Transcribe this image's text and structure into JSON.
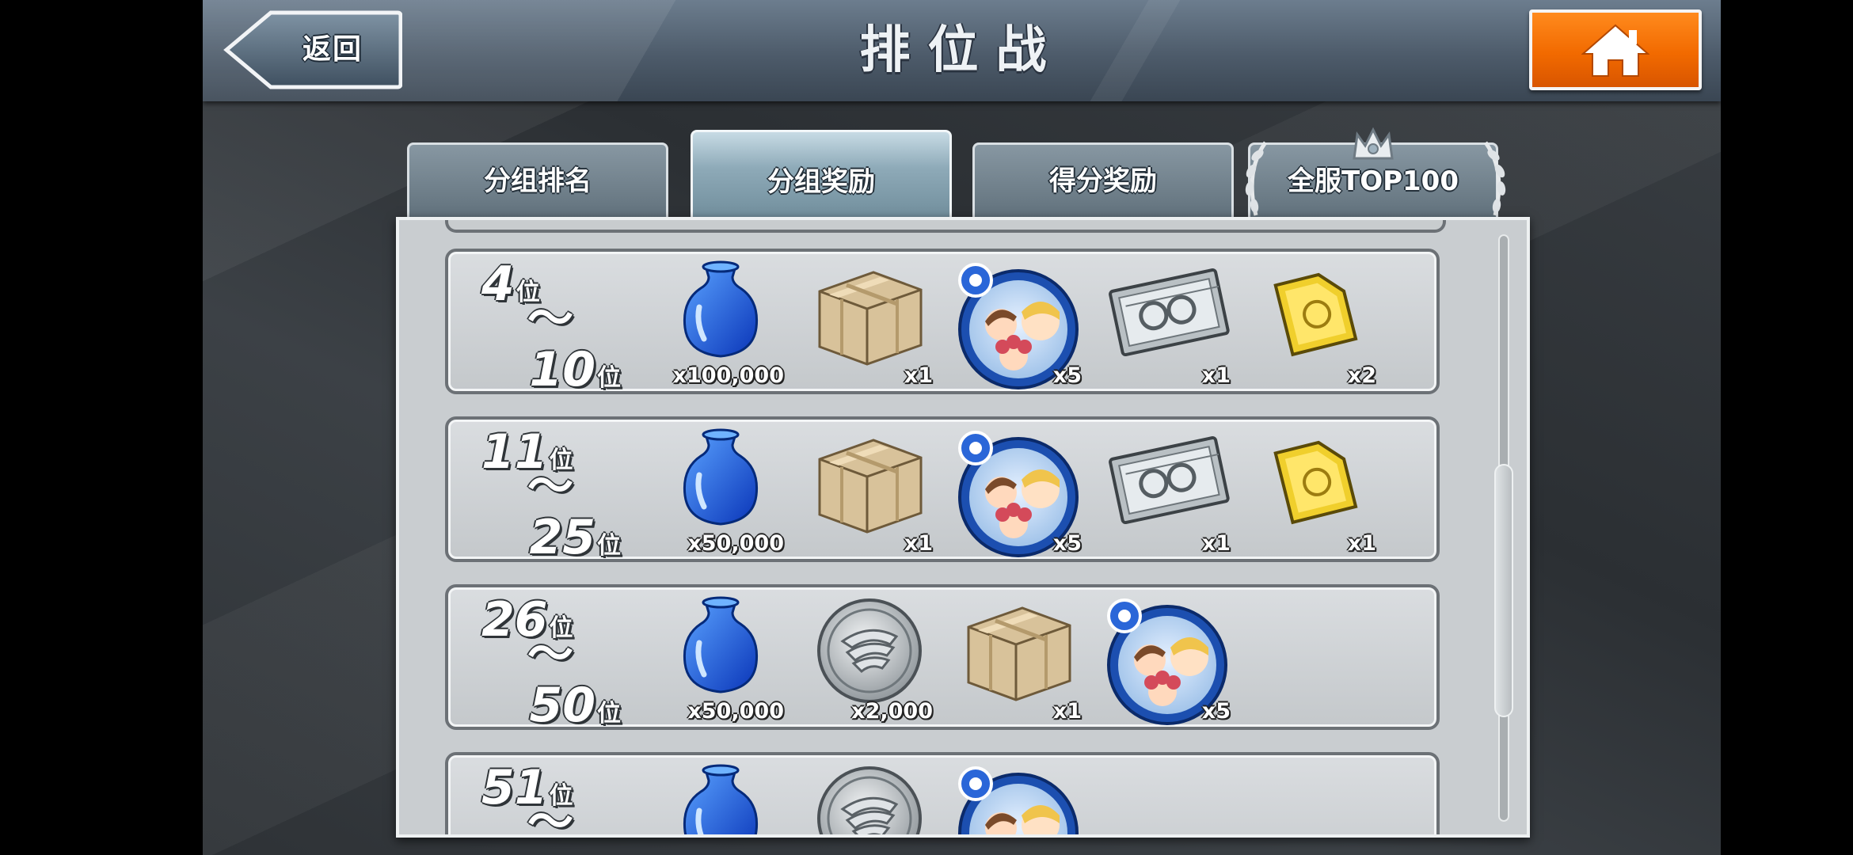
{
  "header": {
    "back_label": "返回",
    "title": "排位战"
  },
  "tabs": [
    {
      "label": "分组排名",
      "active": false
    },
    {
      "label": "分组奖励",
      "active": true
    },
    {
      "label": "得分奖励",
      "active": false
    },
    {
      "label": "全服TOP100",
      "active": false
    }
  ],
  "reward_rows": [
    {
      "rank_from": "4",
      "rank_to": "10",
      "rank_unit": "位",
      "range_separator": "～",
      "rewards": [
        {
          "icon": "blue-potion-icon",
          "qty": "x100,000"
        },
        {
          "icon": "cardboard-box-icon",
          "qty": "x1"
        },
        {
          "icon": "character-medal-icon",
          "qty": "x5"
        },
        {
          "icon": "silver-ticket-icon",
          "qty": "x1"
        },
        {
          "icon": "gold-ticket-icon",
          "qty": "x2"
        }
      ]
    },
    {
      "rank_from": "11",
      "rank_to": "25",
      "rank_unit": "位",
      "range_separator": "～",
      "rewards": [
        {
          "icon": "blue-potion-icon",
          "qty": "x50,000"
        },
        {
          "icon": "cardboard-box-icon",
          "qty": "x1"
        },
        {
          "icon": "character-medal-icon",
          "qty": "x5"
        },
        {
          "icon": "silver-ticket-icon",
          "qty": "x1"
        },
        {
          "icon": "gold-ticket-icon",
          "qty": "x1"
        }
      ]
    },
    {
      "rank_from": "26",
      "rank_to": "50",
      "rank_unit": "位",
      "range_separator": "～",
      "rewards": [
        {
          "icon": "blue-potion-icon",
          "qty": "x50,000"
        },
        {
          "icon": "silver-wing-coin-icon",
          "qty": "x2,000"
        },
        {
          "icon": "cardboard-box-icon",
          "qty": "x1"
        },
        {
          "icon": "character-medal-icon",
          "qty": "x5"
        }
      ]
    },
    {
      "rank_from": "51",
      "rank_unit": "位",
      "range_separator": "～",
      "rewards": [
        {
          "icon": "blue-potion-icon"
        },
        {
          "icon": "silver-wing-coin-icon"
        },
        {
          "icon": "character-medal-icon"
        }
      ]
    }
  ],
  "colors": {
    "home_button": "#f26a00",
    "tab_active": "#8eaab8",
    "panel": "#c9cdd0"
  }
}
